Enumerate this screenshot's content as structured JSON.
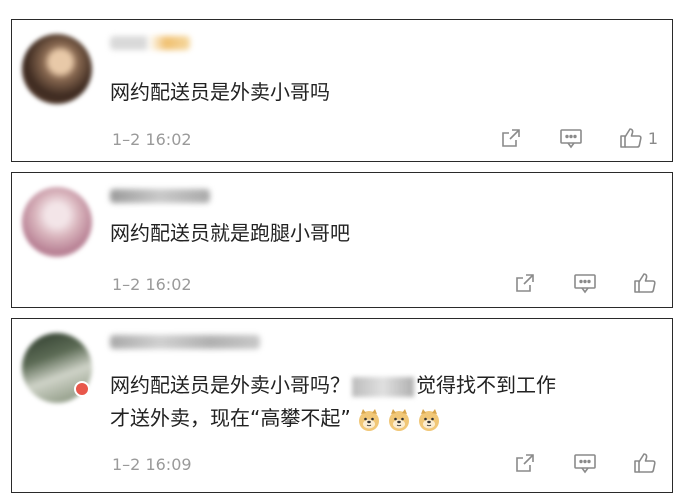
{
  "comments": [
    {
      "text": "网约配送员是外卖小哥吗",
      "time": "1–2 16:02",
      "likes": "1",
      "avatar_icon": "user-avatar-icon"
    },
    {
      "text": "网约配送员就是跑腿小哥吧",
      "time": "1–2 16:02",
      "likes": "",
      "avatar_icon": "user-avatar-icon"
    },
    {
      "text_line1_part1": "网约配送员是外卖小哥吗？",
      "text_line1_part2": "觉得找不到工作",
      "text_line2": "才送外卖，现在“高攀不起”",
      "time": "1–2 16:09",
      "likes": "",
      "avatar_icon": "user-avatar-icon",
      "emoji_icon": "doge-emoji-icon",
      "emoji_count": 3
    }
  ],
  "icons": {
    "share": "share-icon",
    "comment": "comment-icon",
    "like": "thumbs-up-icon"
  },
  "colors": {
    "border": "#2a2a2a",
    "text": "#222222",
    "meta": "#9a9a9a",
    "badge": "#e8574b"
  }
}
